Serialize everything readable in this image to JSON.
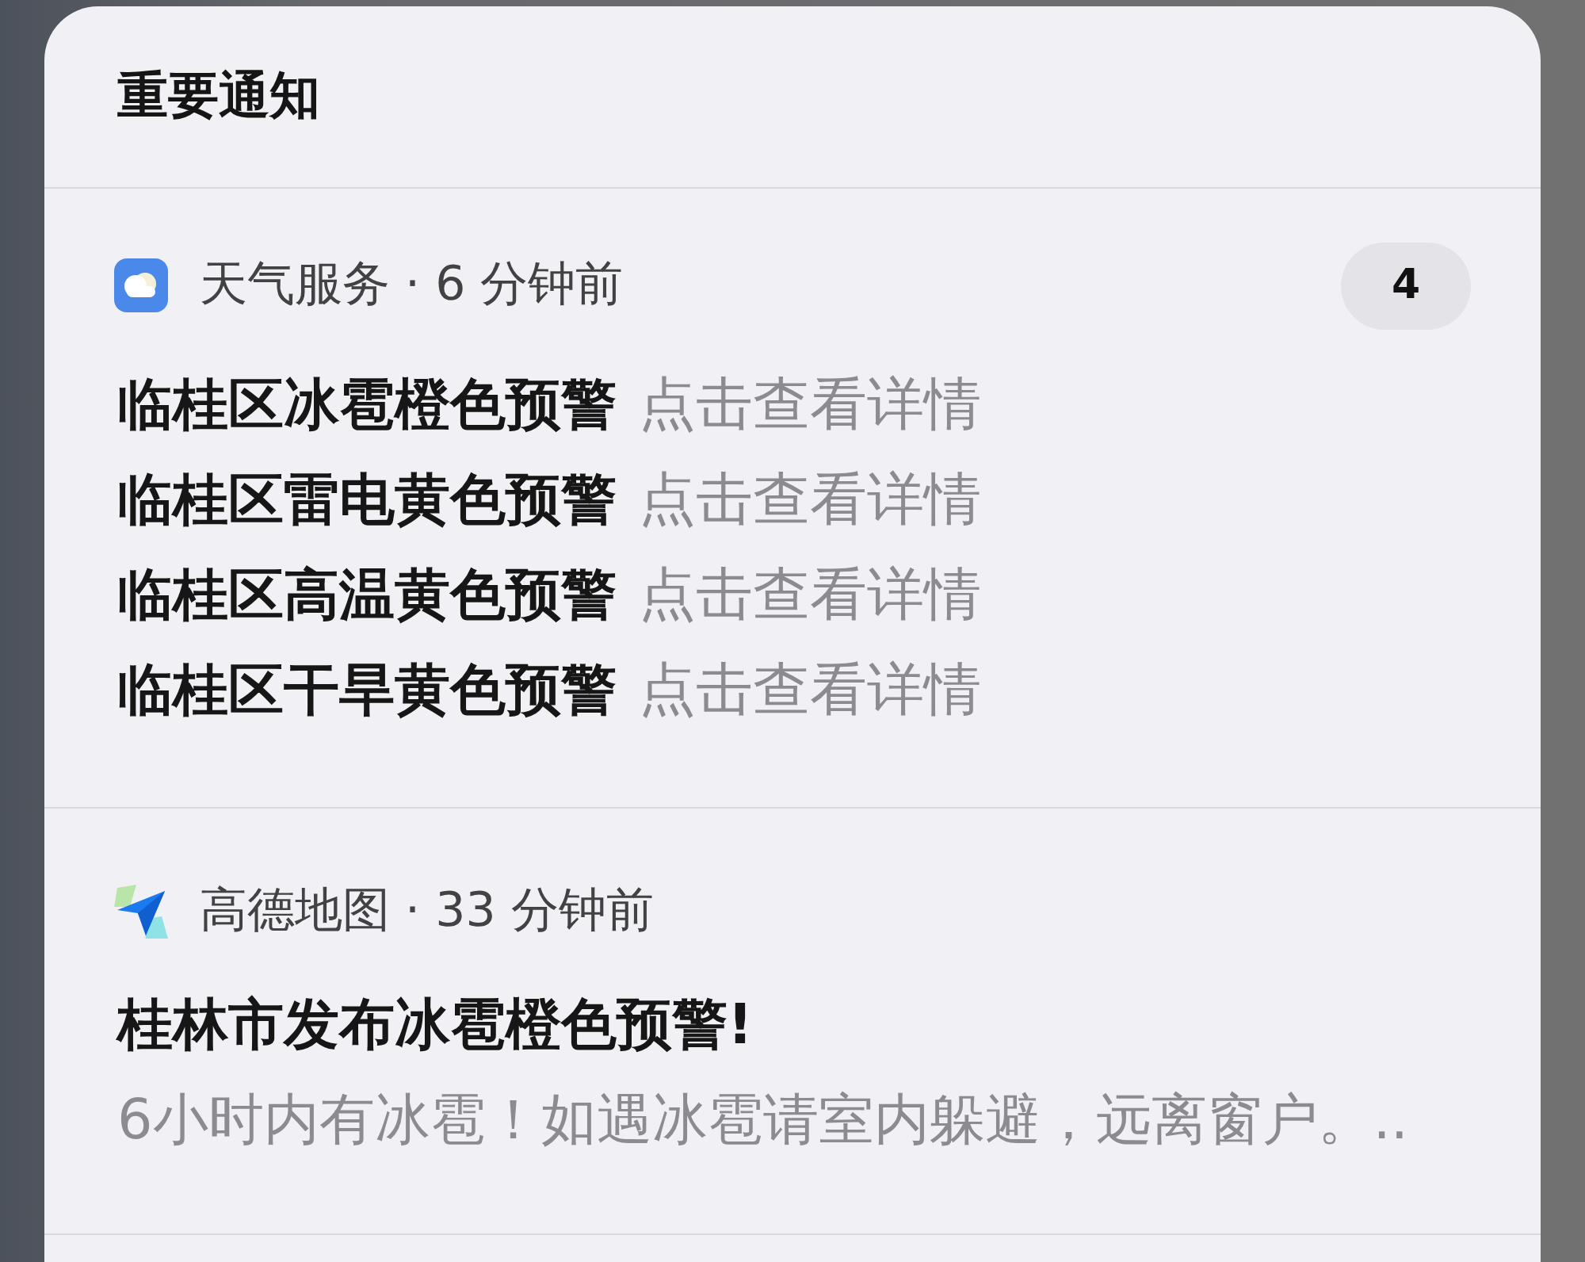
{
  "panel": {
    "title": "重要通知"
  },
  "notifications": [
    {
      "kind": "grouped",
      "source": "天气服务 · 6 分钟前",
      "count": "4",
      "items": [
        {
          "title": "临桂区冰雹橙色预警",
          "hint": "点击查看详情"
        },
        {
          "title": "临桂区雷电黄色预警",
          "hint": "点击查看详情"
        },
        {
          "title": "临桂区高温黄色预警",
          "hint": "点击查看详情"
        },
        {
          "title": "临桂区干旱黄色预警",
          "hint": "点击查看详情"
        }
      ]
    },
    {
      "kind": "single",
      "source": "高德地图 · 33 分钟前",
      "title": "桂林市发布冰雹橙色预警!",
      "body": "6小时内有冰雹！如遇冰雹请室内躲避，远离窗户。.."
    }
  ]
}
